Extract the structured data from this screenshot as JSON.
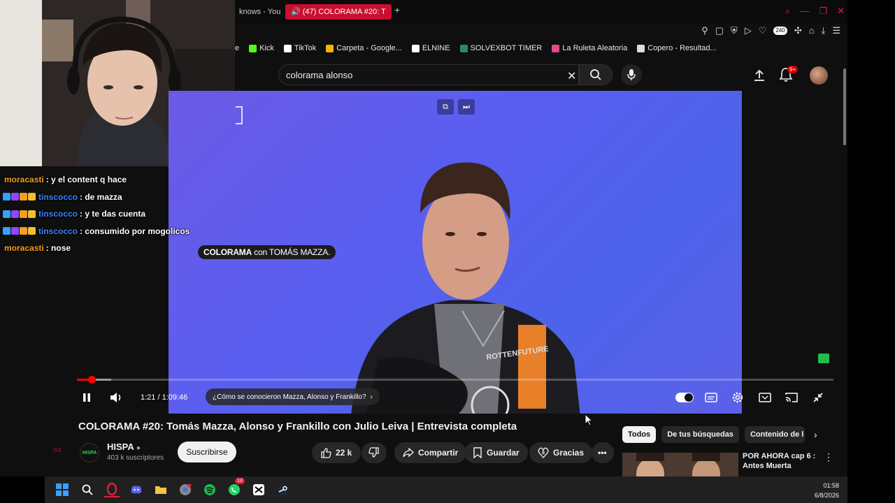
{
  "browser": {
    "tabs": [
      {
        "label": "knows - You"
      },
      {
        "label": "(47) COLORAMA #20: T"
      }
    ],
    "new_tab": "+",
    "toolbar_badge": "240",
    "bookmarks": [
      {
        "label": "e",
        "color": "#333333"
      },
      {
        "label": "Kick",
        "color": "#53fc18"
      },
      {
        "label": "TikTok",
        "color": "#ffffff"
      },
      {
        "label": "Carpeta - Google...",
        "color": "#f4b400"
      },
      {
        "label": "ELNINE",
        "color": "#ffffff"
      },
      {
        "label": "SOLVEXBOT TIMER",
        "color": "#2e8b57"
      },
      {
        "label": "La Ruleta Aleatoria",
        "color": "#e04a8a"
      },
      {
        "label": "Copero - Resultad...",
        "color": "#dddddd"
      }
    ]
  },
  "youtube": {
    "search": {
      "value": "colorama alonso",
      "placeholder": "Buscar"
    },
    "notifications_badge": "9+"
  },
  "video": {
    "caption_bold": "COLORAMA",
    "caption_rest": " con TOMÁS MAZZA.",
    "progress_fraction": 0.019,
    "buffer_fraction": 0.045,
    "time": "1:21 / 1:09:46",
    "chapter": "¿Cómo se conocieron Mazza, Alonso y Frankillo?",
    "title": "COLORAMA #20: Tomás Mazza, Alonso y Frankillo con Julio Leiva | Entrevista completa"
  },
  "channel": {
    "avatar_text": "HISPA",
    "name": "HISPA",
    "subscribers": "403 k suscriptores",
    "subscribe_label": "Suscribirse"
  },
  "actions": {
    "likes": "22 k",
    "share": "Compartir",
    "save": "Guardar",
    "thanks": "Gracias"
  },
  "filters": [
    {
      "label": "Todos",
      "active": true
    },
    {
      "label": "De tus búsquedas",
      "active": false
    },
    {
      "label": "Contenido de l",
      "active": false
    }
  ],
  "recommendation": {
    "title": "POR AHORA cap 6 : Antes Muerta"
  },
  "chat": [
    {
      "user": "moracasti",
      "color": "#f0a020",
      "badges": false,
      "message": ": y el content q hace"
    },
    {
      "user": "tinscocco",
      "color": "#3b82f6",
      "badges": true,
      "message": ": de mazza"
    },
    {
      "user": "tinscocco",
      "color": "#3b82f6",
      "badges": true,
      "message": ": y te das cuenta"
    },
    {
      "user": "tinscocco",
      "color": "#3b82f6",
      "badges": true,
      "message": ": consumido por mogolicos"
    },
    {
      "user": "moracasti",
      "color": "#f0a020",
      "badges": false,
      "message": ": nose"
    }
  ],
  "taskbar": {
    "whatsapp_badge": "13",
    "time": "01:58",
    "date": "6/8/2026"
  },
  "sidebar_mark": "GX",
  "colors": {
    "accent": "#ff0000",
    "opera_red": "#e0203c"
  }
}
